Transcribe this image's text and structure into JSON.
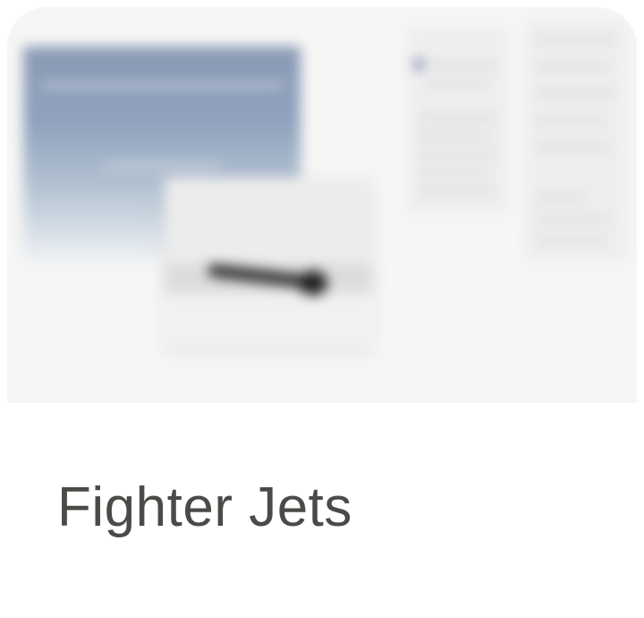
{
  "card": {
    "title": "Fighter Jets"
  },
  "thumbnail": {
    "description_icon": "blurred-page-preview-icon"
  },
  "colors": {
    "title_text": "#4a4a47",
    "thumbnail_background": "#f6f6f5",
    "card_background": "#ffffff"
  }
}
